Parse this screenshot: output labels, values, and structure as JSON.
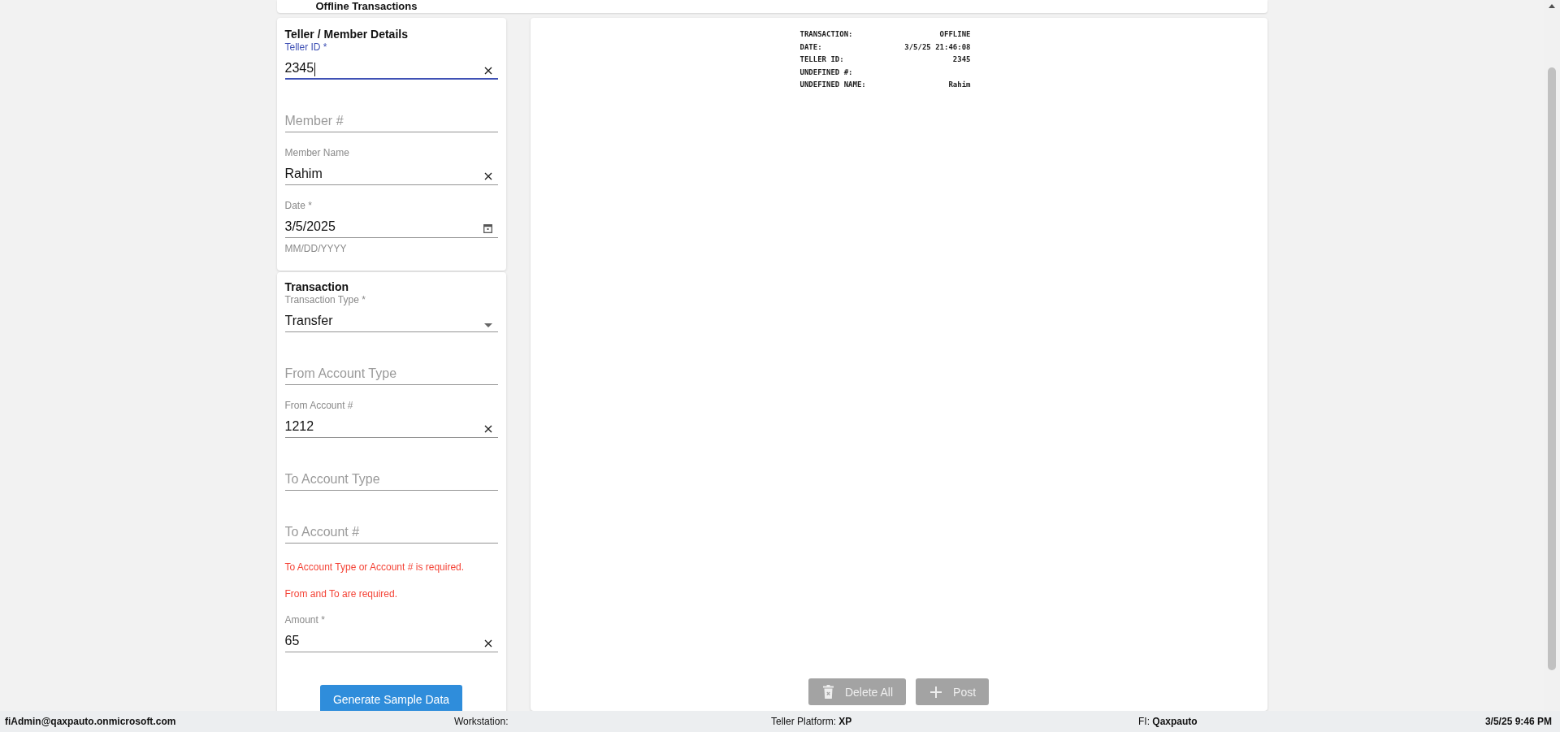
{
  "header": {
    "title": "Offline Transactions"
  },
  "member_card": {
    "heading": "Teller / Member Details",
    "fields": [
      {
        "kind": "text",
        "label": "Teller ID *",
        "value": "2345",
        "focused": true,
        "clearable": true
      },
      {
        "kind": "text",
        "placeholder": "Member #",
        "focused": false,
        "clearable": false
      },
      {
        "kind": "text",
        "label": "Member Name",
        "value": "Rahim",
        "focused": false,
        "clearable": true
      },
      {
        "kind": "date",
        "label": "Date *",
        "value": "3/5/2025",
        "focused": false,
        "clearable": false,
        "helper": "MM/DD/YYYY"
      }
    ]
  },
  "transaction_card": {
    "heading": "Transaction",
    "fields": [
      {
        "kind": "select",
        "label": "Transaction Type *",
        "value": "Transfer",
        "focused": false,
        "clearable": false
      },
      {
        "kind": "text",
        "placeholder": "From Account Type",
        "focused": false,
        "clearable": false
      },
      {
        "kind": "text",
        "label": "From Account #",
        "value": "1212",
        "focused": false,
        "clearable": true
      },
      {
        "kind": "text",
        "placeholder": "To Account Type",
        "focused": false,
        "clearable": false
      },
      {
        "kind": "text",
        "placeholder": "To Account #",
        "focused": false,
        "clearable": false
      }
    ],
    "errors": [
      "To Account Type or Account # is required.",
      "From and To are required."
    ],
    "amount": {
      "label": "Amount *",
      "value": "65",
      "focused": false,
      "clearable": true
    },
    "generate_button": {
      "label": "Generate Sample Data",
      "disabled": false
    }
  },
  "receipt": {
    "lines": [
      {
        "label": "TRANSACTION:",
        "value": "OFFLINE"
      },
      {
        "label": "DATE:",
        "value": "3/5/25 21:46:08"
      },
      {
        "label": "TELLER ID:",
        "value": "2345"
      },
      {
        "label": "UNDEFINED #:"
      },
      {
        "label": "UNDEFINED NAME:",
        "value": "Rahim"
      }
    ]
  },
  "actions": [
    {
      "kind": "delete",
      "label": "Delete All",
      "disabled": true
    },
    {
      "kind": "add",
      "label": "Post",
      "disabled": true
    }
  ],
  "status_bar": {
    "user": "fiAdmin@qaxpauto.onmicrosoft.com",
    "workstation": "Workstation:",
    "platform": "Teller Platform: **XP**",
    "fi": "FI: **Qaxpauto**",
    "datetime": "3/5/25 9:46 PM"
  }
}
